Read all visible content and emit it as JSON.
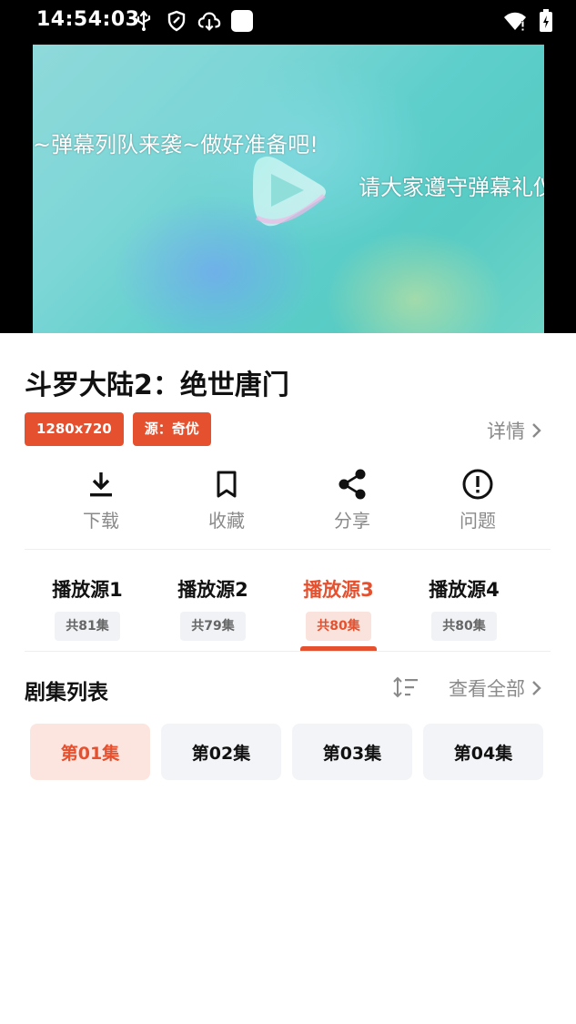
{
  "status_bar": {
    "time": "14:54:03",
    "icons_left": [
      "usb-icon",
      "shield-icon",
      "cloud-download-icon",
      "square-icon"
    ],
    "icons_right": [
      "wifi-icon",
      "battery-icon"
    ]
  },
  "player": {
    "danmaku": [
      "~弹幕列队来袭~做好准备吧!",
      "请大家遵守弹幕礼仪，为"
    ]
  },
  "video": {
    "title": "斗罗大陆2：绝世唐门",
    "tags": [
      "1280x720",
      "源：奇优"
    ],
    "detail_label": "详情"
  },
  "actions": [
    {
      "label": "下载",
      "icon": "download-icon"
    },
    {
      "label": "收藏",
      "icon": "bookmark-icon"
    },
    {
      "label": "分享",
      "icon": "share-icon"
    },
    {
      "label": "问题",
      "icon": "alert-circle-icon"
    }
  ],
  "sources": [
    {
      "name": "播放源1",
      "count": "共81集",
      "active": false
    },
    {
      "name": "播放源2",
      "count": "共79集",
      "active": false
    },
    {
      "name": "播放源3",
      "count": "共80集",
      "active": true
    },
    {
      "name": "播放源4",
      "count": "共80集",
      "active": false
    }
  ],
  "episodes_section": {
    "title": "剧集列表",
    "view_all_label": "查看全部",
    "items": [
      {
        "label": "第01集",
        "active": true
      },
      {
        "label": "第02集",
        "active": false
      },
      {
        "label": "第03集",
        "active": false
      },
      {
        "label": "第04集",
        "active": false
      }
    ]
  },
  "colors": {
    "accent": "#e5512f",
    "accent_light": "#fde5df",
    "muted_text": "#8a8a8a",
    "chip_bg": "#f3f4f7"
  }
}
